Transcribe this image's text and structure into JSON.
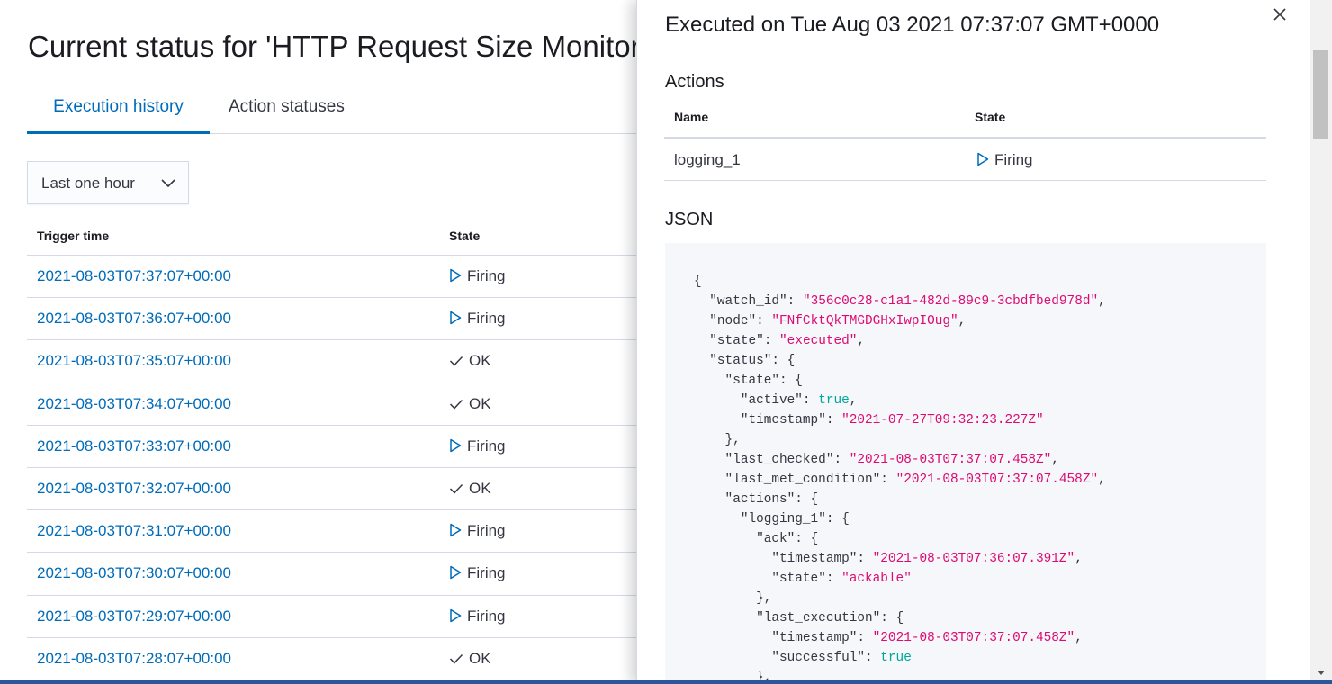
{
  "page": {
    "title": "Current status for 'HTTP Request Size Monitor'",
    "tabs": [
      {
        "label": "Execution history",
        "selected": true
      },
      {
        "label": "Action statuses",
        "selected": false
      }
    ],
    "time_range": {
      "selected": "Last one hour"
    },
    "history_table": {
      "columns": [
        "Trigger time",
        "State"
      ],
      "rows": [
        {
          "time": "2021-08-03T07:37:07+00:00",
          "state": "Firing"
        },
        {
          "time": "2021-08-03T07:36:07+00:00",
          "state": "Firing"
        },
        {
          "time": "2021-08-03T07:35:07+00:00",
          "state": "OK"
        },
        {
          "time": "2021-08-03T07:34:07+00:00",
          "state": "OK"
        },
        {
          "time": "2021-08-03T07:33:07+00:00",
          "state": "Firing"
        },
        {
          "time": "2021-08-03T07:32:07+00:00",
          "state": "OK"
        },
        {
          "time": "2021-08-03T07:31:07+00:00",
          "state": "Firing"
        },
        {
          "time": "2021-08-03T07:30:07+00:00",
          "state": "Firing"
        },
        {
          "time": "2021-08-03T07:29:07+00:00",
          "state": "Firing"
        },
        {
          "time": "2021-08-03T07:28:07+00:00",
          "state": "OK"
        }
      ]
    }
  },
  "flyout": {
    "title": "Executed on Tue Aug 03 2021 07:37:07 GMT+0000",
    "close_icon": "close-icon",
    "actions_heading": "Actions",
    "actions_table": {
      "columns": [
        "Name",
        "State"
      ],
      "rows": [
        {
          "name": "logging_1",
          "state": "Firing"
        }
      ]
    },
    "json_heading": "JSON",
    "json_lines": [
      [
        [
          "p",
          "{"
        ]
      ],
      [
        [
          "p",
          "  \""
        ],
        [
          "k",
          "watch_id"
        ],
        [
          "p",
          "\": "
        ],
        [
          "s",
          "\"356c0c28-c1a1-482d-89c9-3cbdfbed978d\""
        ],
        [
          "p",
          ","
        ]
      ],
      [
        [
          "p",
          "  \""
        ],
        [
          "k",
          "node"
        ],
        [
          "p",
          "\": "
        ],
        [
          "s",
          "\"FNfCktQkTMGDGHxIwpIOug\""
        ],
        [
          "p",
          ","
        ]
      ],
      [
        [
          "p",
          "  \""
        ],
        [
          "k",
          "state"
        ],
        [
          "p",
          "\": "
        ],
        [
          "s",
          "\"executed\""
        ],
        [
          "p",
          ","
        ]
      ],
      [
        [
          "p",
          "  \""
        ],
        [
          "k",
          "status"
        ],
        [
          "p",
          "\": {"
        ]
      ],
      [
        [
          "p",
          "    \""
        ],
        [
          "k",
          "state"
        ],
        [
          "p",
          "\": {"
        ]
      ],
      [
        [
          "p",
          "      \""
        ],
        [
          "k",
          "active"
        ],
        [
          "p",
          "\": "
        ],
        [
          "b",
          "true"
        ],
        [
          "p",
          ","
        ]
      ],
      [
        [
          "p",
          "      \""
        ],
        [
          "k",
          "timestamp"
        ],
        [
          "p",
          "\": "
        ],
        [
          "s",
          "\"2021-07-27T09:32:23.227Z\""
        ]
      ],
      [
        [
          "p",
          "    },"
        ]
      ],
      [
        [
          "p",
          "    \""
        ],
        [
          "k",
          "last_checked"
        ],
        [
          "p",
          "\": "
        ],
        [
          "s",
          "\"2021-08-03T07:37:07.458Z\""
        ],
        [
          "p",
          ","
        ]
      ],
      [
        [
          "p",
          "    \""
        ],
        [
          "k",
          "last_met_condition"
        ],
        [
          "p",
          "\": "
        ],
        [
          "s",
          "\"2021-08-03T07:37:07.458Z\""
        ],
        [
          "p",
          ","
        ]
      ],
      [
        [
          "p",
          "    \""
        ],
        [
          "k",
          "actions"
        ],
        [
          "p",
          "\": {"
        ]
      ],
      [
        [
          "p",
          "      \""
        ],
        [
          "k",
          "logging_1"
        ],
        [
          "p",
          "\": {"
        ]
      ],
      [
        [
          "p",
          "        \""
        ],
        [
          "k",
          "ack"
        ],
        [
          "p",
          "\": {"
        ]
      ],
      [
        [
          "p",
          "          \""
        ],
        [
          "k",
          "timestamp"
        ],
        [
          "p",
          "\": "
        ],
        [
          "s",
          "\"2021-08-03T07:36:07.391Z\""
        ],
        [
          "p",
          ","
        ]
      ],
      [
        [
          "p",
          "          \""
        ],
        [
          "k",
          "state"
        ],
        [
          "p",
          "\": "
        ],
        [
          "s",
          "\"ackable\""
        ]
      ],
      [
        [
          "p",
          "        },"
        ]
      ],
      [
        [
          "p",
          "        \""
        ],
        [
          "k",
          "last_execution"
        ],
        [
          "p",
          "\": {"
        ]
      ],
      [
        [
          "p",
          "          \""
        ],
        [
          "k",
          "timestamp"
        ],
        [
          "p",
          "\": "
        ],
        [
          "s",
          "\"2021-08-03T07:37:07.458Z\""
        ],
        [
          "p",
          ","
        ]
      ],
      [
        [
          "p",
          "          \""
        ],
        [
          "k",
          "successful"
        ],
        [
          "p",
          "\": "
        ],
        [
          "b",
          "true"
        ]
      ],
      [
        [
          "p",
          "        },"
        ]
      ]
    ]
  },
  "colors": {
    "link": "#006bb8",
    "json_string": "#dd0a73",
    "json_boolean": "#00a69b",
    "border": "#d3dae6"
  }
}
